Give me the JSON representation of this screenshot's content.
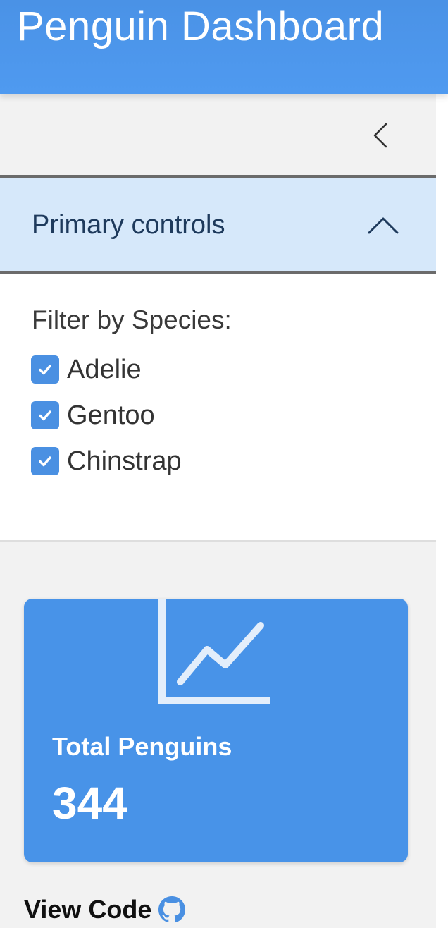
{
  "header": {
    "title": "Penguin Dashboard"
  },
  "sidebar": {
    "collapse_icon": "chevron-left-icon",
    "accordion": {
      "title": "Primary controls",
      "expanded": true,
      "toggle_icon": "chevron-up-icon",
      "filter": {
        "label": "Filter by Species:",
        "options": [
          {
            "label": "Adelie",
            "checked": true
          },
          {
            "label": "Gentoo",
            "checked": true
          },
          {
            "label": "Chinstrap",
            "checked": true
          }
        ]
      }
    }
  },
  "value_box": {
    "icon": "line-chart-icon",
    "title": "Total Penguins",
    "value": "344"
  },
  "footer": {
    "view_code_label": "View Code",
    "icon": "github-icon"
  },
  "colors": {
    "accent": "#4a92e6",
    "accordion_bg": "#d6e8fa",
    "sidebar_bg": "#f2f2f2",
    "checkbox": "#4a90e2",
    "value_box_bg": "#4893e8"
  }
}
